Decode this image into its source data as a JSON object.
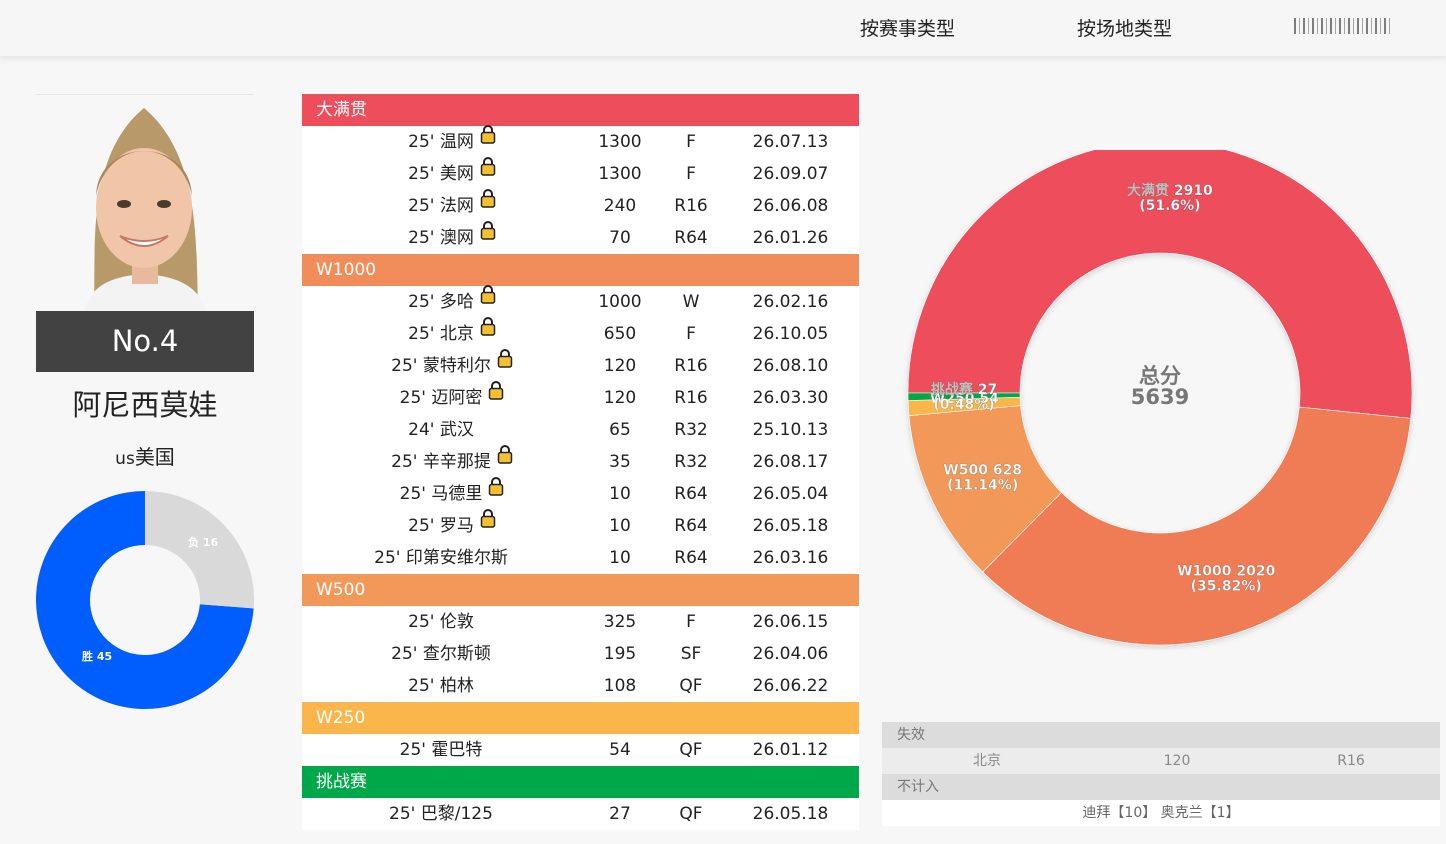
{
  "nav": {
    "items": [
      "按赛事类型",
      "按场地类型"
    ]
  },
  "player": {
    "rank": "No.4",
    "name": "阿尼西莫娃",
    "country_code": "us",
    "country": "美国"
  },
  "win_loss": {
    "win_label": "胜 45",
    "loss_label": "负 16",
    "wins": 45,
    "losses": 16,
    "win_color": "#005eff",
    "loss_color": "#d9d9d9"
  },
  "results": {
    "categories": [
      {
        "name": "大满贯",
        "color": "#ee4d5c",
        "rows": [
          {
            "event": "25' 温网",
            "locked": true,
            "points": "1300",
            "round": "F",
            "date": "26.07.13"
          },
          {
            "event": "25' 美网",
            "locked": true,
            "points": "1300",
            "round": "F",
            "date": "26.09.07"
          },
          {
            "event": "25' 法网",
            "locked": true,
            "points": "240",
            "round": "R16",
            "date": "26.06.08"
          },
          {
            "event": "25' 澳网",
            "locked": true,
            "points": "70",
            "round": "R64",
            "date": "26.01.26"
          }
        ]
      },
      {
        "name": "W1000",
        "color": "#f18c5b",
        "rows": [
          {
            "event": "25' 多哈",
            "locked": true,
            "points": "1000",
            "round": "W",
            "date": "26.02.16"
          },
          {
            "event": "25' 北京",
            "locked": true,
            "points": "650",
            "round": "F",
            "date": "26.10.05"
          },
          {
            "event": "25' 蒙特利尔",
            "locked": true,
            "points": "120",
            "round": "R16",
            "date": "26.08.10"
          },
          {
            "event": "25' 迈阿密",
            "locked": true,
            "points": "120",
            "round": "R16",
            "date": "26.03.30"
          },
          {
            "event": "24' 武汉",
            "locked": false,
            "points": "65",
            "round": "R32",
            "date": "25.10.13"
          },
          {
            "event": "25' 辛辛那提",
            "locked": true,
            "points": "35",
            "round": "R32",
            "date": "26.08.17"
          },
          {
            "event": "25' 马德里",
            "locked": true,
            "points": "10",
            "round": "R64",
            "date": "26.05.04"
          },
          {
            "event": "25' 罗马",
            "locked": true,
            "points": "10",
            "round": "R64",
            "date": "26.05.18"
          },
          {
            "event": "25' 印第安维尔斯",
            "locked": false,
            "points": "10",
            "round": "R64",
            "date": "26.03.16"
          }
        ]
      },
      {
        "name": "W500",
        "color": "#f2995a",
        "rows": [
          {
            "event": "25' 伦敦",
            "locked": false,
            "points": "325",
            "round": "F",
            "date": "26.06.15"
          },
          {
            "event": "25' 查尔斯顿",
            "locked": false,
            "points": "195",
            "round": "SF",
            "date": "26.04.06"
          },
          {
            "event": "25' 柏林",
            "locked": false,
            "points": "108",
            "round": "QF",
            "date": "26.06.22"
          }
        ]
      },
      {
        "name": "W250",
        "color": "#fbb64b",
        "rows": [
          {
            "event": "25' 霍巴特",
            "locked": false,
            "points": "54",
            "round": "QF",
            "date": "26.01.12"
          }
        ]
      },
      {
        "name": "挑战赛",
        "color": "#00a84a",
        "rows": [
          {
            "event": "25' 巴黎/125",
            "locked": false,
            "points": "27",
            "round": "QF",
            "date": "26.05.18"
          }
        ]
      }
    ]
  },
  "chart_data": {
    "type": "pie",
    "center_label": "总分",
    "total": "5639",
    "slices": [
      {
        "name": "大满贯",
        "value": 2910,
        "percent": "51.6%",
        "color": "#ee4d5c"
      },
      {
        "name": "W1000",
        "value": 2020,
        "percent": "35.82%",
        "color": "#f07c55"
      },
      {
        "name": "W500",
        "value": 628,
        "percent": "11.14%",
        "color": "#f2995a"
      },
      {
        "name": "W250",
        "value": 54,
        "percent": "",
        "color": "#fbb64b"
      },
      {
        "name": "挑战赛",
        "value": 27,
        "percent": "0.48%",
        "color": "#00a84a"
      }
    ]
  },
  "expiry": {
    "expired_label": "失效",
    "expired_row": {
      "event": "北京",
      "points": "120",
      "round": "R16"
    },
    "excluded_label": "不计入",
    "excluded_note": "迪拜【10】 奥克兰【1】"
  }
}
